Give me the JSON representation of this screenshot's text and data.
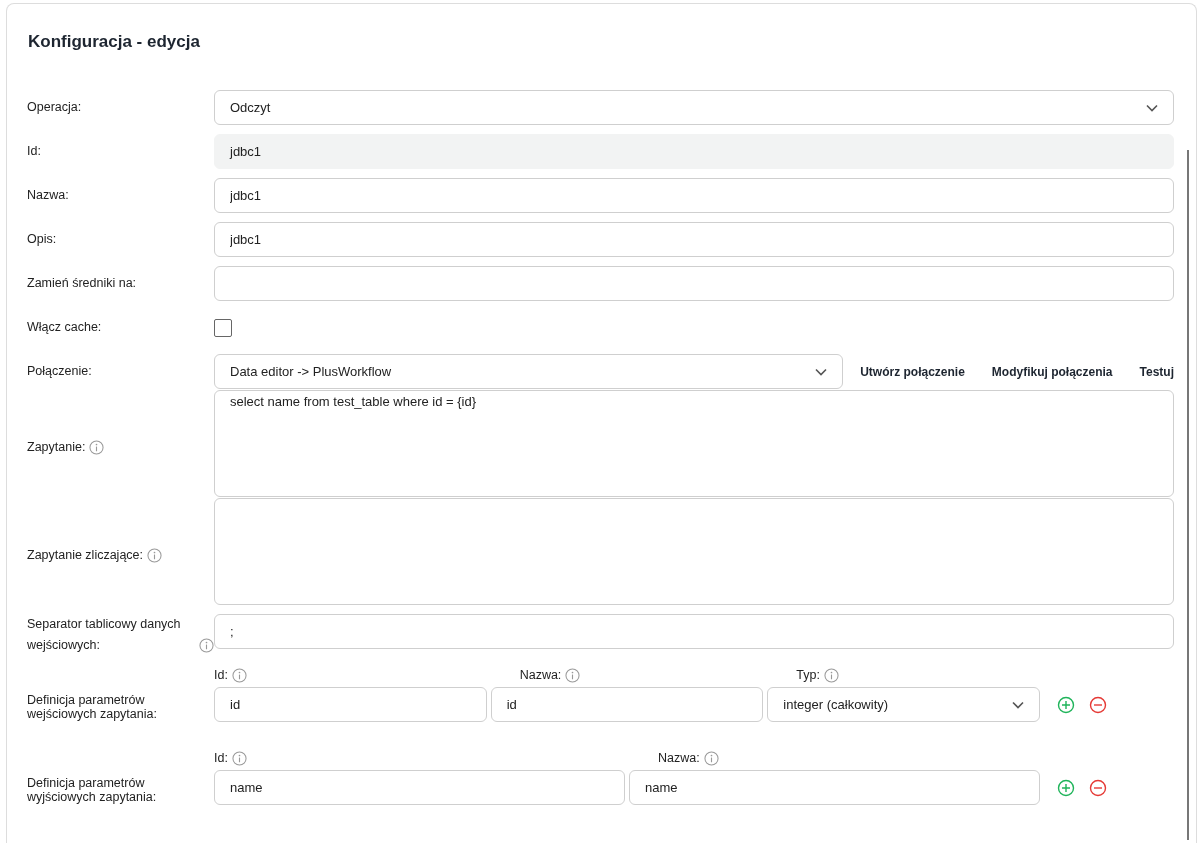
{
  "title": "Konfiguracja - edycja",
  "fields": [
    {
      "label": "Operacja:",
      "kind": "select",
      "value": "Odczyt"
    },
    {
      "label": "Id:",
      "kind": "readonly",
      "value": "jdbc1"
    },
    {
      "label": "Nazwa:",
      "kind": "text",
      "value": "jdbc1"
    },
    {
      "label": "Opis:",
      "kind": "text",
      "value": "jdbc1"
    },
    {
      "label": "Zamień średniki na:",
      "kind": "text"
    },
    {
      "label": "Włącz cache:",
      "kind": "checkbox",
      "checked": false
    },
    {
      "label": "Połączenie:",
      "kind": "connection",
      "value": "Data editor -> PlusWorkflow",
      "actions": [
        "Utwórz połączenie",
        "Modyfikuj połączenia",
        "Testuj"
      ]
    },
    {
      "label": "Zapytanie:",
      "kind": "textarea",
      "info": true,
      "value": "select name from test_table where id = {id}"
    },
    {
      "label": "Zapytanie zliczające:",
      "kind": "textarea",
      "info": true
    },
    {
      "label": "Separator tablicowy danych wejściowych:",
      "kind": "text",
      "info": true,
      "value": ";"
    }
  ],
  "param_sections": [
    {
      "label": "Definicja parametrów wejściowych zapytania:",
      "columns": [
        {
          "label": "Id:",
          "kind": "text"
        },
        {
          "label": "Nazwa:",
          "kind": "text"
        },
        {
          "label": "Typ:",
          "kind": "select"
        }
      ],
      "rows": [
        {
          "values": [
            "id",
            "id",
            "integer (całkowity)"
          ]
        }
      ]
    },
    {
      "label": "Definicja parametrów wyjściowych zapytania:",
      "columns": [
        {
          "label": "Id:",
          "kind": "text"
        },
        {
          "label": "Nazwa:",
          "kind": "text"
        }
      ],
      "rows": [
        {
          "values": [
            "name",
            "name"
          ]
        }
      ]
    }
  ]
}
